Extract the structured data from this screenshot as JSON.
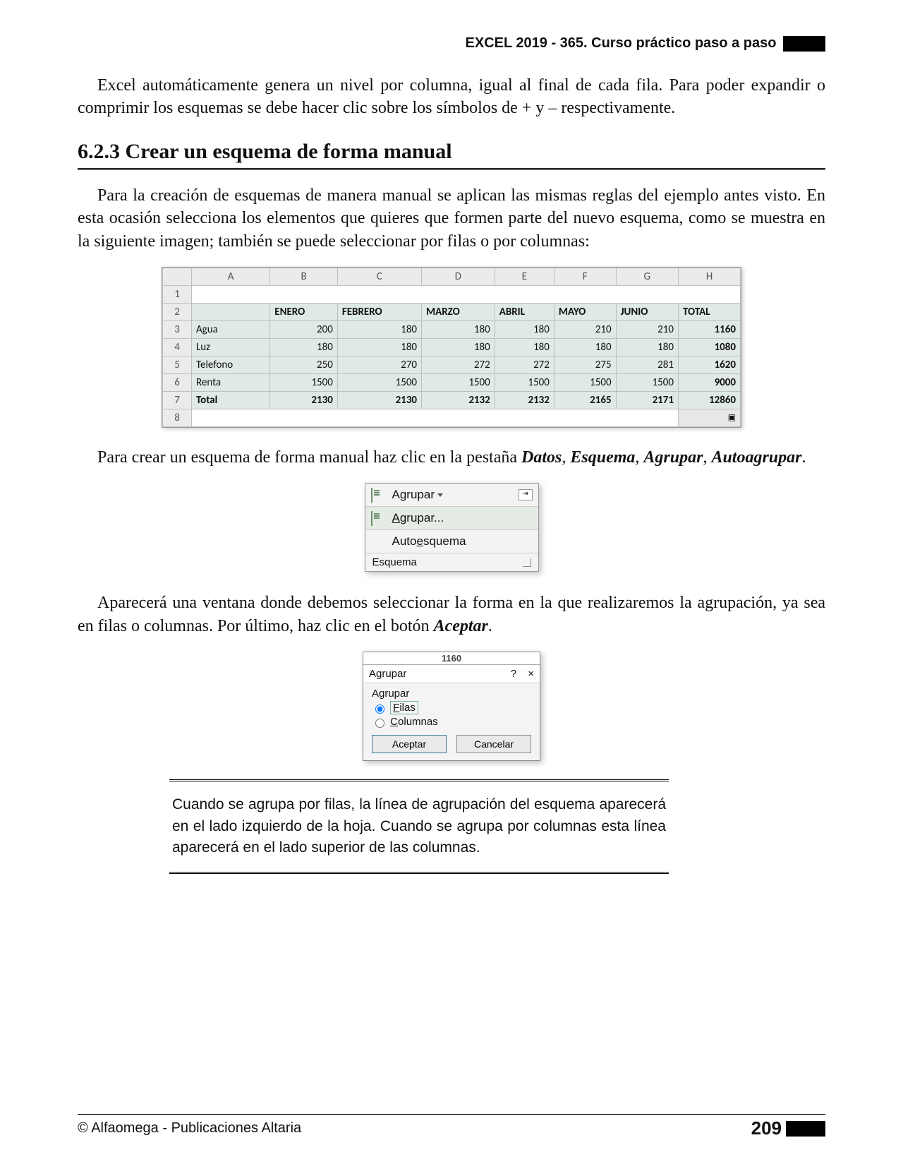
{
  "header": {
    "title": "EXCEL 2019 - 365. Curso práctico paso a paso"
  },
  "para1": "Excel automáticamente genera un nivel por columna, igual al final de cada fila. Para poder expandir o comprimir los esquemas se debe hacer clic sobre los símbolos de + y – respectivamente.",
  "sectionHeading": "6.2.3 Crear un esquema de forma manual",
  "para2": "Para la creación de esquemas de manera manual se aplican las mismas reglas del ejemplo antes visto. En esta ocasión selecciona los elementos que quieres que formen parte del nuevo esquema, como se muestra en la siguiente imagen; también se puede seleccionar por filas o por columnas:",
  "excel": {
    "cols": [
      "A",
      "B",
      "C",
      "D",
      "E",
      "F",
      "G",
      "H"
    ],
    "headers": [
      "",
      "ENERO",
      "FEBRERO",
      "MARZO",
      "ABRIL",
      "MAYO",
      "JUNIO",
      "TOTAL"
    ],
    "rows": [
      {
        "n": "3",
        "label": "Agua",
        "vals": [
          200,
          180,
          180,
          180,
          210,
          210,
          1160
        ]
      },
      {
        "n": "4",
        "label": "Luz",
        "vals": [
          180,
          180,
          180,
          180,
          180,
          180,
          1080
        ]
      },
      {
        "n": "5",
        "label": "Telefono",
        "vals": [
          250,
          270,
          272,
          272,
          275,
          281,
          1620
        ]
      },
      {
        "n": "6",
        "label": "Renta",
        "vals": [
          1500,
          1500,
          1500,
          1500,
          1500,
          1500,
          9000
        ]
      },
      {
        "n": "7",
        "label": "Total",
        "vals": [
          2130,
          2130,
          2132,
          2132,
          2165,
          2171,
          12860
        ]
      }
    ]
  },
  "para3_prefix": "Para crear un esquema de forma manual haz clic en la pestaña ",
  "para3_labels": {
    "datos": "Datos",
    "esquema": "Esquema",
    "agrupar": "Agrupar",
    "autoagrupar": "Autoagrupar"
  },
  "menu": {
    "top": "Agrupar",
    "item1": "Agrupar...",
    "item2": "Autoesquema",
    "footer": "Esquema"
  },
  "para4_prefix": "Aparecerá una ventana donde debemos seleccionar la forma en la que realizaremos la agrupación, ya sea en filas o columnas. Por último, haz clic en el botón ",
  "para4_aceptar": "Aceptar",
  "dialog": {
    "peek": "1160",
    "title": "Agrupar",
    "help": "?",
    "close": "×",
    "groupLabel": "Agrupar",
    "optRows": "Filas",
    "optCols": "Columnas",
    "ok": "Aceptar",
    "cancel": "Cancelar"
  },
  "note": "Cuando se agrupa por filas, la línea de agrupación del esquema aparecerá en el lado izquierdo de la hoja. Cuando se agrupa por columnas esta línea aparecerá en el lado superior de las columnas.",
  "footer": {
    "copyright": "© Alfaomega - Publicaciones Altaria",
    "page": "209"
  }
}
